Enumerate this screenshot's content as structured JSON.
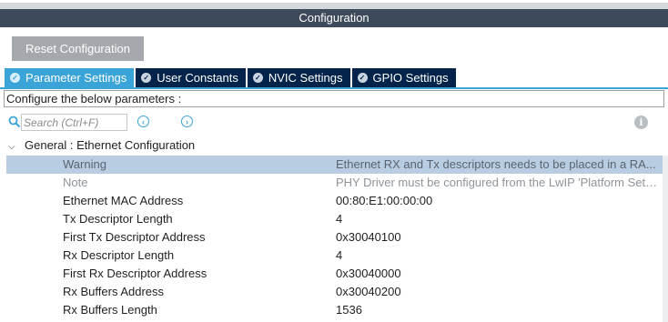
{
  "window": {
    "title": "Configuration"
  },
  "toolbar": {
    "reset_label": "Reset Configuration"
  },
  "tabs": [
    {
      "label": "Parameter Settings",
      "active": true
    },
    {
      "label": "User Constants",
      "active": false
    },
    {
      "label": "NVIC Settings",
      "active": false
    },
    {
      "label": "GPIO Settings",
      "active": false
    }
  ],
  "configure_text": "Configure the below parameters :",
  "search": {
    "placeholder": "Search (Ctrl+F)",
    "value": ""
  },
  "group": {
    "label": "General : Ethernet Configuration",
    "expanded": true
  },
  "parameters": [
    {
      "name": "Warning",
      "value": "Ethernet RX and Tx descriptors needs to be placed in a RA..."
    },
    {
      "name": "Note",
      "value": "PHY Driver must be configured from the LwIP 'Platform Setti..."
    },
    {
      "name": "Ethernet MAC Address",
      "value": "00:80:E1:00:00:00"
    },
    {
      "name": "Tx Descriptor Length",
      "value": "4"
    },
    {
      "name": "First Tx Descriptor Address",
      "value": "0x30040100"
    },
    {
      "name": "Rx Descriptor Length",
      "value": "4"
    },
    {
      "name": "First Rx Descriptor Address",
      "value": "0x30040000"
    },
    {
      "name": "Rx Buffers Address",
      "value": "0x30040200"
    },
    {
      "name": "Rx Buffers Length",
      "value": "1536"
    }
  ],
  "icons": {
    "tab_check": "check-circle-icon",
    "search": "search-icon",
    "prev": "chevron-left-icon",
    "next": "chevron-right-icon",
    "info": "info-icon",
    "group_toggle": "chevron-down-icon"
  },
  "colors": {
    "title_bar": "#3c4a5c",
    "tab_active": "#3aa3d7",
    "tab_inactive": "#03234b",
    "reset_button": "#a5a8ac",
    "selected_row": "#b8cde2"
  }
}
